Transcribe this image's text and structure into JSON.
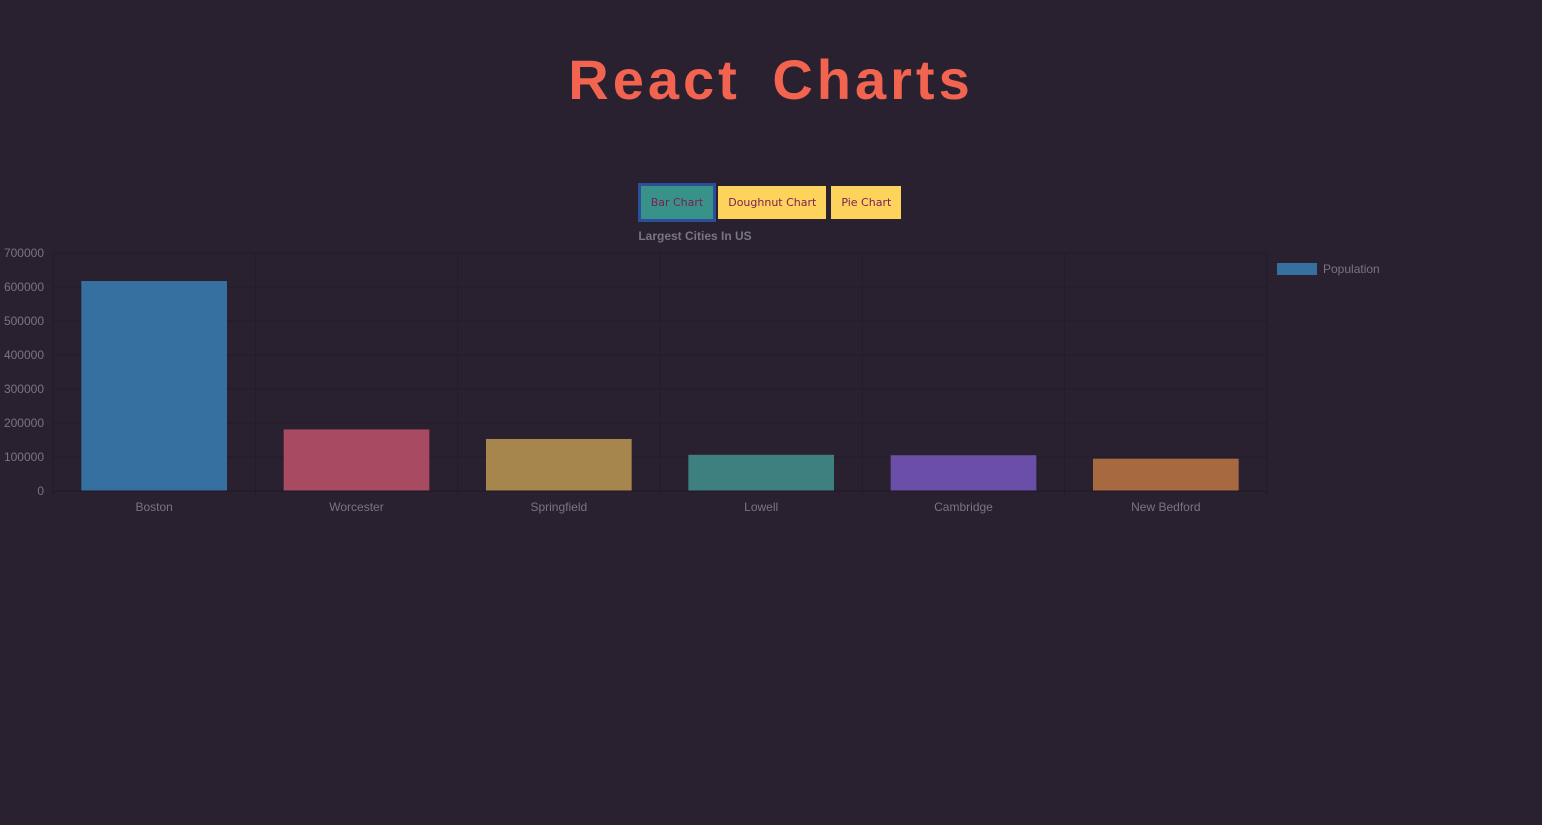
{
  "app": {
    "title": "React Charts"
  },
  "colors": {
    "background": "#2a2130",
    "title": "#f26450",
    "button_active_bg": "#39928a",
    "button_inactive_bg": "#fdd35c",
    "button_text": "#7a1d5a",
    "muted_text": "#7a7480",
    "grid": "#231b28"
  },
  "buttons": [
    {
      "label": "Bar Chart",
      "active": true
    },
    {
      "label": "Doughnut Chart",
      "active": false
    },
    {
      "label": "Pie Chart",
      "active": false
    }
  ],
  "chart_data": {
    "type": "bar",
    "title": "Largest Cities In US",
    "xlabel": "",
    "ylabel": "",
    "categories": [
      "Boston",
      "Worcester",
      "Springfield",
      "Lowell",
      "Cambridge",
      "New Bedford"
    ],
    "series": [
      {
        "name": "Population",
        "values": [
          617594,
          181045,
          153060,
          106519,
          105162,
          95072
        ],
        "colors": [
          "#3570a0",
          "#a74a62",
          "#a6864c",
          "#3e7f7f",
          "#6b4ea8",
          "#a76a40"
        ]
      }
    ],
    "legend_color": "#3570a0",
    "yticks": [
      0,
      100000,
      200000,
      300000,
      400000,
      500000,
      600000,
      700000
    ],
    "ylim": [
      0,
      700000
    ],
    "grid": true,
    "legend_position": "right"
  }
}
